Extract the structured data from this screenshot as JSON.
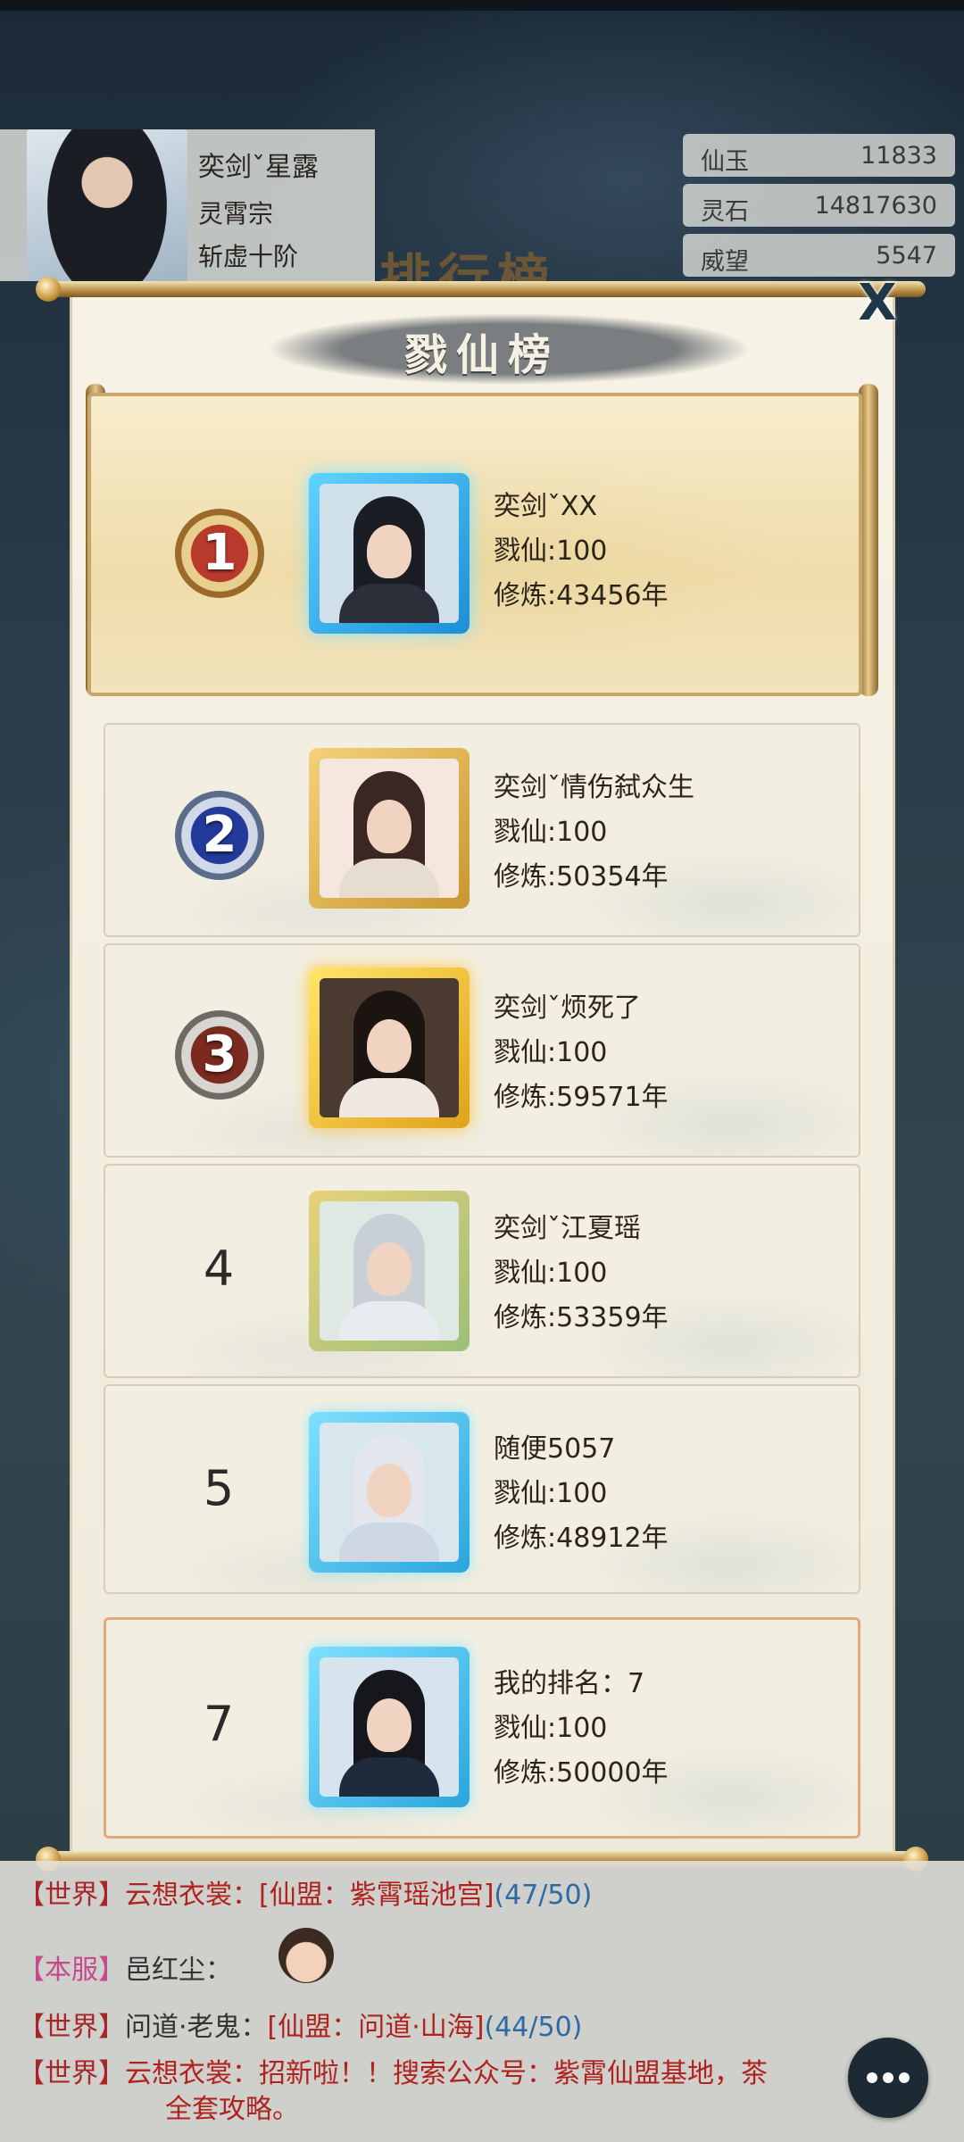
{
  "player": {
    "name": "奕剑ˇ星露",
    "sect": "灵霄宗",
    "realm": "斩虚十阶"
  },
  "resources": [
    {
      "label": "仙玉",
      "value": "11833"
    },
    {
      "label": "灵石",
      "value": "14817630"
    },
    {
      "label": "威望",
      "value": "5547"
    }
  ],
  "background": {
    "title": "排行榜"
  },
  "modal": {
    "title": "戮仙榜",
    "close_label": "X"
  },
  "ranking": [
    {
      "rank": "1",
      "name": "奕剑ˇXX",
      "kill": "戮仙:100",
      "cultivation": "修炼:43456年"
    },
    {
      "rank": "2",
      "name": "奕剑ˇ情伤弑众生",
      "kill": "戮仙:100",
      "cultivation": "修炼:50354年"
    },
    {
      "rank": "3",
      "name": "奕剑ˇ烦死了",
      "kill": "戮仙:100",
      "cultivation": "修炼:59571年"
    },
    {
      "rank": "4",
      "name": "奕剑ˇ江夏瑶",
      "kill": "戮仙:100",
      "cultivation": "修炼:53359年"
    },
    {
      "rank": "5",
      "name": "随便5057",
      "kill": "戮仙:100",
      "cultivation": "修炼:48912年"
    }
  ],
  "my_rank": {
    "rank": "7",
    "label": "我的排名：7",
    "kill": "戮仙:100",
    "cultivation": "修炼:50000年"
  },
  "chat": [
    {
      "channel": "【世界】",
      "sender": "云想衣裳：",
      "message": "[仙盟：紫霄瑶池宫]",
      "suffix": "(47/50)"
    },
    {
      "channel": "【本服】",
      "sender": "邑红尘：",
      "message": "",
      "suffix": ""
    },
    {
      "channel": "【世界】",
      "sender": "问道·老鬼：",
      "message": "[仙盟：问道·山海]",
      "suffix": "(44/50)"
    },
    {
      "channel": "【世界】",
      "sender": "云想衣裳：",
      "message": "招新啦！！搜索公众号：紫霄仙盟基地，茶",
      "suffix": "全套攻略。"
    }
  ],
  "colors": {
    "gold": "#c7a86a",
    "my_rank_border": "#e2a77a",
    "world_channel": "#a8262a",
    "server_channel": "#c44a8c",
    "guild_link": "#2b6aa4"
  }
}
